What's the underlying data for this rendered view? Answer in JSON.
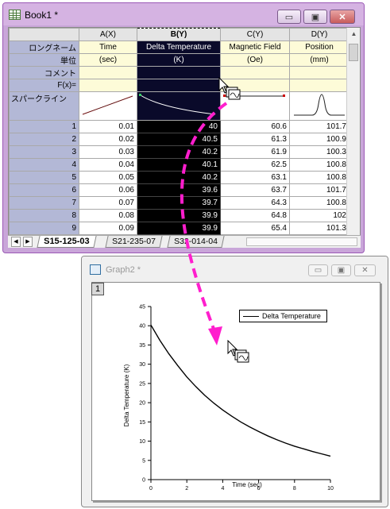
{
  "book": {
    "title": "Book1 *",
    "min_label": "▭",
    "max_label": "▣",
    "close_label": "✕",
    "columns": [
      {
        "header": "A(X)"
      },
      {
        "header": "B(Y)"
      },
      {
        "header": "C(Y)"
      },
      {
        "header": "D(Y)"
      }
    ],
    "row_labels": {
      "long_name": "ロングネーム",
      "units": "単位",
      "comments": "コメント",
      "fx": "F(x)=",
      "sparklines": "スパークライン"
    },
    "long_names": [
      "Time",
      "Delta Temperature",
      "Magnetic Field",
      "Position"
    ],
    "units": [
      "(sec)",
      "(K)",
      "(Oe)",
      "(mm)"
    ],
    "rows": [
      {
        "n": "1",
        "a": "0.01",
        "b": "40",
        "c": "60.6",
        "d": "101.7"
      },
      {
        "n": "2",
        "a": "0.02",
        "b": "40.5",
        "c": "61.3",
        "d": "100.9"
      },
      {
        "n": "3",
        "a": "0.03",
        "b": "40.2",
        "c": "61.9",
        "d": "100.3"
      },
      {
        "n": "4",
        "a": "0.04",
        "b": "40.1",
        "c": "62.5",
        "d": "100.8"
      },
      {
        "n": "5",
        "a": "0.05",
        "b": "40.2",
        "c": "63.1",
        "d": "100.8"
      },
      {
        "n": "6",
        "a": "0.06",
        "b": "39.6",
        "c": "63.7",
        "d": "101.7"
      },
      {
        "n": "7",
        "a": "0.07",
        "b": "39.7",
        "c": "64.3",
        "d": "100.8"
      },
      {
        "n": "8",
        "a": "0.08",
        "b": "39.9",
        "c": "64.8",
        "d": "102"
      },
      {
        "n": "9",
        "a": "0.09",
        "b": "39.9",
        "c": "65.4",
        "d": "101.3"
      }
    ],
    "sheets": [
      "S15-125-03",
      "S21-235-07",
      "S32-014-04"
    ],
    "active_sheet": "S15-125-03"
  },
  "graph": {
    "title": "Graph2 *",
    "layer": "1",
    "min_label": "▭",
    "max_label": "▣",
    "close_label": "✕"
  },
  "chart_data": {
    "type": "line",
    "title": "",
    "xlabel": "Time (sec)",
    "ylabel": "Delta Temperature (K)",
    "xlim": [
      0,
      10
    ],
    "ylim": [
      0,
      45
    ],
    "xticks": [
      "0",
      "2",
      "4",
      "6",
      "8",
      "10"
    ],
    "yticks": [
      "0",
      "5",
      "10",
      "15",
      "20",
      "25",
      "30",
      "35",
      "40",
      "45"
    ],
    "legend_position": "top-right",
    "series": [
      {
        "name": "Delta Temperature",
        "x": [
          0,
          0.5,
          1,
          1.5,
          2,
          2.5,
          3,
          3.5,
          4,
          4.5,
          5,
          5.5,
          6,
          6.5,
          7,
          7.5,
          8,
          8.5,
          9,
          9.5,
          10
        ],
        "y": [
          40.2,
          36.2,
          32.7,
          29.6,
          26.7,
          24.2,
          21.9,
          19.9,
          18.1,
          16.5,
          15.0,
          13.7,
          12.5,
          11.4,
          10.4,
          9.5,
          8.7,
          8.0,
          7.3,
          6.7,
          6.1
        ]
      }
    ]
  }
}
